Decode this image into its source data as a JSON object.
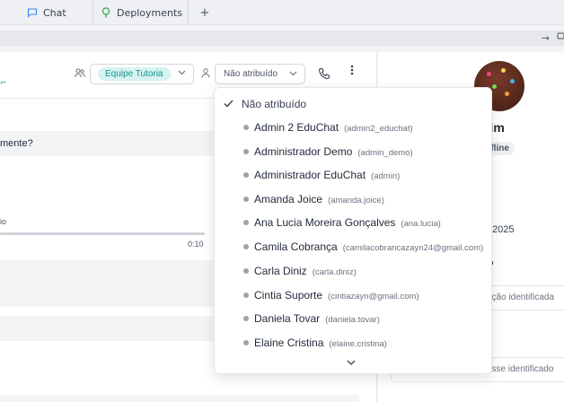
{
  "tabs": [
    {
      "label": "Chat",
      "icon": "chat-bubble-icon"
    },
    {
      "label": "Deployments",
      "icon": "tree-icon"
    }
  ],
  "tab_add": "+",
  "address_bar": {
    "arrow": "→"
  },
  "header": {
    "team_label": "Equipe Tutoria",
    "assignee_label": "Não atribuído",
    "colors": {
      "accent": "#0f9488",
      "pill_bg": "#d6f3f1"
    }
  },
  "messages": {
    "partial_text": "mente?",
    "audio_label": "io",
    "audio_time": "0:10"
  },
  "right_panel": {
    "name_fragment": "mim",
    "status": "ffline",
    "date_fragment": "2025",
    "mark": "o",
    "box1": "ação identificada",
    "box2": "esse identificado"
  },
  "dropdown": {
    "selected": "Não atribuído",
    "items": [
      {
        "name": "Admin 2 EduChat",
        "username": "(admin2_educhat)"
      },
      {
        "name": "Administrador Demo",
        "username": "(admin_demo)"
      },
      {
        "name": "Administrador EduChat",
        "username": "(admin)"
      },
      {
        "name": "Amanda Joice",
        "username": "(amanda.joice)"
      },
      {
        "name": "Ana Lucia Moreira Gonçalves",
        "username": "(ana.lucia)"
      },
      {
        "name": "Camila Cobrança",
        "username": "(camilacobrancazayn24@gmail.com)"
      },
      {
        "name": "Carla Diniz",
        "username": "(carla.diniz)"
      },
      {
        "name": "Cintia Suporte",
        "username": "(cintiazayn@gmail.com)"
      },
      {
        "name": "Daniela Tovar",
        "username": "(daniela.tovar)"
      },
      {
        "name": "Elaine Cristina",
        "username": "(elaine.cristina)"
      }
    ]
  }
}
